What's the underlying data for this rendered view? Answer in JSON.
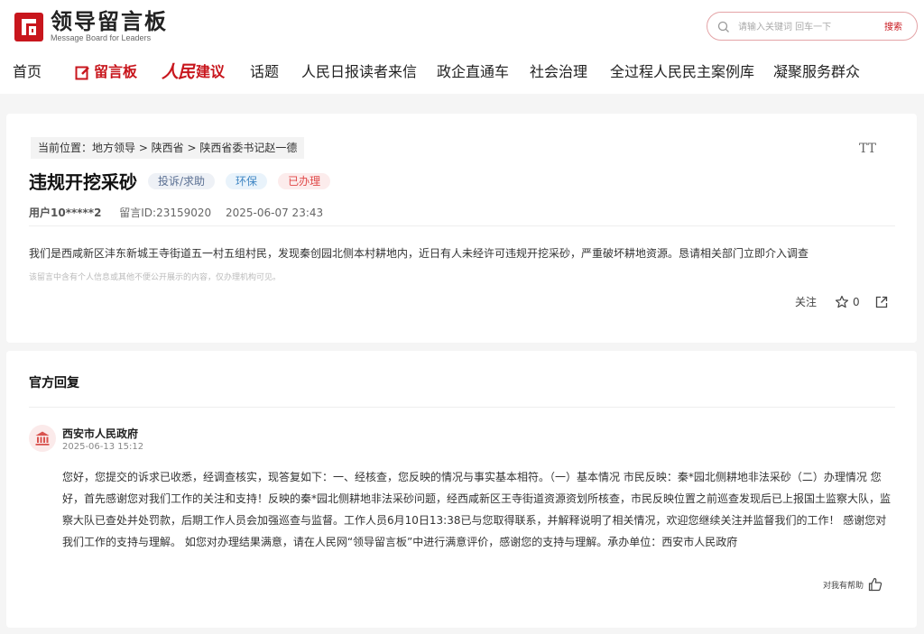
{
  "brand": {
    "name_cn": "领导留言板",
    "name_en": "Message Board for Leaders",
    "accent": "#c8161d"
  },
  "search": {
    "placeholder": "请输入关键词 回车一下",
    "button_label": "搜索"
  },
  "nav": {
    "items": [
      {
        "label": "首页"
      },
      {
        "label": "留言板",
        "active": true
      },
      {
        "label_script": "人民",
        "label": "建议"
      },
      {
        "label": "话题"
      },
      {
        "label": "人民日报读者来信"
      },
      {
        "label": "政企直通车"
      },
      {
        "label": "社会治理"
      },
      {
        "label": "全过程人民民主案例库"
      },
      {
        "label": "凝聚服务群众"
      }
    ]
  },
  "message": {
    "breadcrumb": "当前位置：地方领导 > 陕西省 > 陕西省委书记赵一德",
    "font_size_icon": "TT",
    "title": "违规开挖采砂",
    "tags": {
      "type": "投诉/求助",
      "field": "环保",
      "status": "已办理"
    },
    "user": "用户10*****2",
    "message_id": "留言ID:23159020",
    "datetime": "2025-06-07 23:43",
    "content": "我们是西咸新区沣东新城王寺街道五一村五组村民，发现秦创园北侧本村耕地内，近日有人未经许可违规开挖采砂，严重破坏耕地资源。恳请相关部门立即介入调查",
    "privacy_note": "该留言中含有个人信息或其他不便公开展示的内容，仅办理机构可见。",
    "actions": {
      "follow_label": "关注",
      "star_count": "0"
    }
  },
  "reply": {
    "heading": "官方回复",
    "org_name": "西安市人民政府",
    "date": "2025-06-13 15:12",
    "body": "您好，您提交的诉求已收悉，经调查核实，现答复如下：一、经核查，您反映的情况与事实基本相符。（一）基本情况 市民反映：秦*园北侧耕地非法采砂（二）办理情况 您好，首先感谢您对我们工作的关注和支持！反映的秦*园北侧耕地非法采砂问题，经西咸新区王寺街道资源资划所核查，市民反映位置之前巡查发现后已上报国土监察大队，监察大队已查处并处罚款，后期工作人员会加强巡查与监督。工作人员6月10日13:38已与您取得联系，并解释说明了相关情况，欢迎您继续关注并监督我们的工作！ 感谢您对我们工作的支持与理解。 如您对办理结果满意，请在人民网“领导留言板”中进行满意评价，感谢您的支持与理解。承办单位：西安市人民政府",
    "helpful_label": "对我有帮助"
  }
}
